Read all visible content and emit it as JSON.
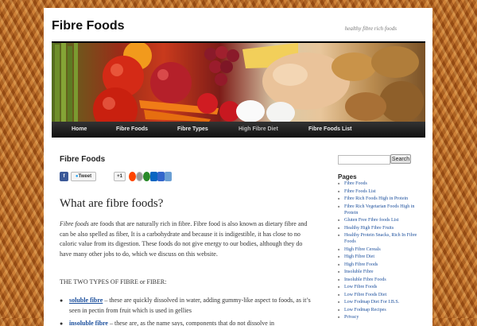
{
  "site": {
    "title": "Fibre Foods",
    "description": "healthy fibre rich foods"
  },
  "nav": {
    "items": [
      {
        "label": "Home"
      },
      {
        "label": "Fibre Foods"
      },
      {
        "label": "Fibre Types"
      },
      {
        "label": "High Fibre Diet"
      },
      {
        "label": "Fibre Foods List"
      }
    ]
  },
  "content": {
    "title": "Fibre Foods",
    "share": {
      "tweet": "Tweet",
      "gplus": "+1"
    },
    "heading": "What are fibre foods?",
    "intro_term": "Fibre foods",
    "intro_rest": " are foods that are naturally rich in fibre. Fibre food is also known as dietary fibre and can be also spelled as fiber, It is a carbohydrate and because it is indigestible, it has close to no caloric value from its digestion. These  foods do not give energy to our bodies, although they do have many other jobs to do, which we discuss on this website.",
    "types_line": "THE TWO TYPES OF FIBRE or FIBER:",
    "bullets": [
      {
        "link": "soluble fibre",
        "text": " – these are quickly dissolved in water, adding gummy-like aspect to foods, as it’s seen in pectin from fruit which is used in gellies"
      },
      {
        "link": "insoluble fibre",
        "text": " – these are, as the name says, components that do not dissolve in"
      }
    ]
  },
  "sidebar": {
    "search_value": "",
    "search_button": "Search",
    "pages_heading": "Pages",
    "pages": [
      "Fibre Foods",
      "Fibre Foods List",
      "Fibre Rich Foods High in Protein",
      "Fibre Rich Vegetarian Foods High in Protein",
      "Gluten Free Fibre foods List",
      "Healthy High Fibre Fruits",
      "Healthy Protein Snacks, Rich In Fibre Foods",
      "High Fibre Cereals",
      "High Fibre Diet",
      "High Fibre Foods",
      "Insoluble Fibre",
      "Insoluble Fibre Foods",
      "Low Fibre Foods",
      "Low Fibre Foods Diet",
      "Low Fodmap Diet For I.B.S.",
      "Low Fodmap Recipes",
      "Privacy"
    ]
  },
  "colors": {
    "link": "#1a4e9c",
    "nav_bg": "#222222",
    "background": "#b8641e"
  }
}
